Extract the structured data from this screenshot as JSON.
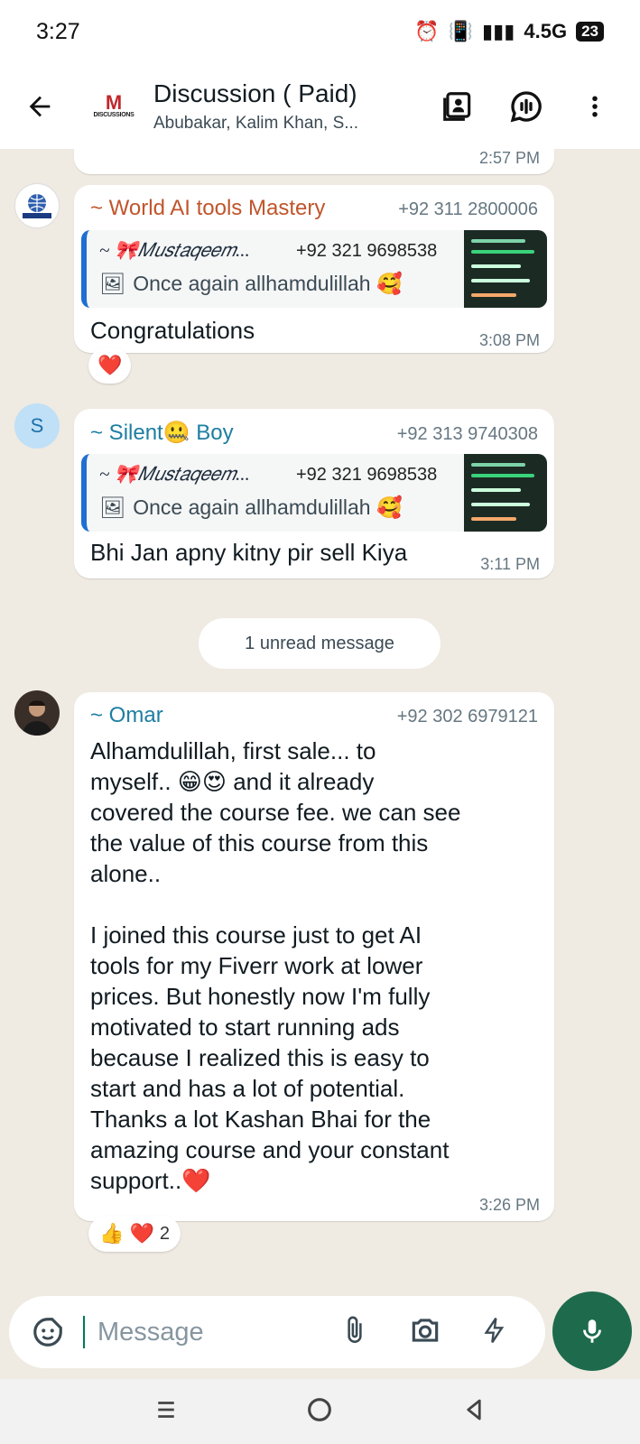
{
  "status": {
    "time": "3:27",
    "network": "4.5G",
    "battery": "23"
  },
  "header": {
    "group_logo_text": "DISCUSSIONS",
    "title": "Discussion ( Paid)",
    "subtitle": "Abubakar, Kalim Khan, S..."
  },
  "chat": {
    "prev_time": "2:57 PM",
    "messages": [
      {
        "sender": "~ World AI tools Mastery",
        "phone": "+92 311 2800006",
        "sender_color": "#c0552b",
        "avatar": "WORLD AI TOOLS",
        "quote": {
          "name": "~ 🎀𝑀𝑢𝑠𝑡𝑎𝑞𝑒𝑒𝑚...",
          "phone": "+92 321 9698538",
          "text": "Once again allhamdulillah 🥰"
        },
        "text": "Congratulations",
        "time": "3:08 PM",
        "reactions": "❤️"
      },
      {
        "sender": "~ Silent🤐 Boy",
        "phone": "+92 313 9740308",
        "sender_color": "#1e7ea1",
        "avatar": "S",
        "quote": {
          "name": "~ 🎀𝑀𝑢𝑠𝑡𝑎𝑞𝑒𝑒𝑚...",
          "phone": "+92 321 9698538",
          "text": "Once again allhamdulillah 🥰"
        },
        "text": "Bhi Jan apny kitny pir sell Kiya",
        "time": "3:11 PM"
      },
      {
        "sender": "~ Omar",
        "phone": "+92 302 6979121",
        "sender_color": "#1e7ea1",
        "text_lines": [
          "Alhamdulillah, first sale... to",
          "myself.. 😁😍 and it already",
          "covered the course fee. we can see",
          "the value of this course from this",
          "alone..",
          "",
          "I joined this course just to get AI",
          "tools for my Fiverr work at lower",
          "prices. But honestly now I'm fully",
          "motivated to start running ads",
          "because I realized this is easy to",
          "start and has a lot of potential.",
          "Thanks a lot Kashan Bhai for the",
          "amazing course and your constant",
          "support..❤️"
        ],
        "time": "3:26 PM",
        "reactions": "👍 ❤️",
        "reaction_count": "2"
      }
    ],
    "unread_label": "1 unread message"
  },
  "input": {
    "placeholder": "Message"
  }
}
